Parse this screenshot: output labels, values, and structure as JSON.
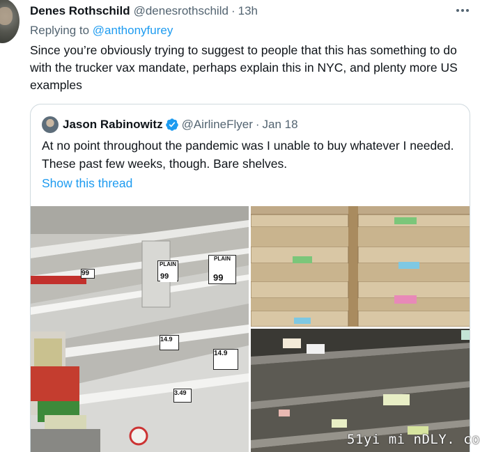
{
  "tweet": {
    "author_name": "Denes Rothschild",
    "author_handle": "@denesrothschild",
    "separator": "·",
    "time": "13h",
    "replying_label": "Replying to",
    "replying_handle": "@anthonyfurey",
    "text": "Since you’re obviously trying to suggest to people that this has something to do with the trucker vax mandate, perhaps explain this in NYC, and plenty more US examples"
  },
  "quoted": {
    "author_name": "Jason Rabinowitz",
    "author_handle": "@AirlineFlyer",
    "separator": "·",
    "date": "Jan 18",
    "text": "At no point throughout the pandemic was I unable to buy whatever I needed. These past few weeks, though. Bare shelves.",
    "show_thread": "Show this thread",
    "photos": [
      {
        "subject": "empty refrigerated dairy shelves",
        "labels": [
          "99",
          "PLAIN",
          "99",
          "PLAIN",
          "99",
          "14.9",
          "14.9",
          "3.49"
        ]
      },
      {
        "subject": "empty wooden produce shelves"
      },
      {
        "subject": "empty metal wire shelves"
      }
    ]
  },
  "icons": {
    "more": "more-horizontal-icon",
    "verified": "verified-badge-icon"
  },
  "colors": {
    "accent": "#1d9bf0",
    "secondary_text": "#536471",
    "border": "#cfd9de"
  },
  "watermark": "51yi mi nDLY. co"
}
